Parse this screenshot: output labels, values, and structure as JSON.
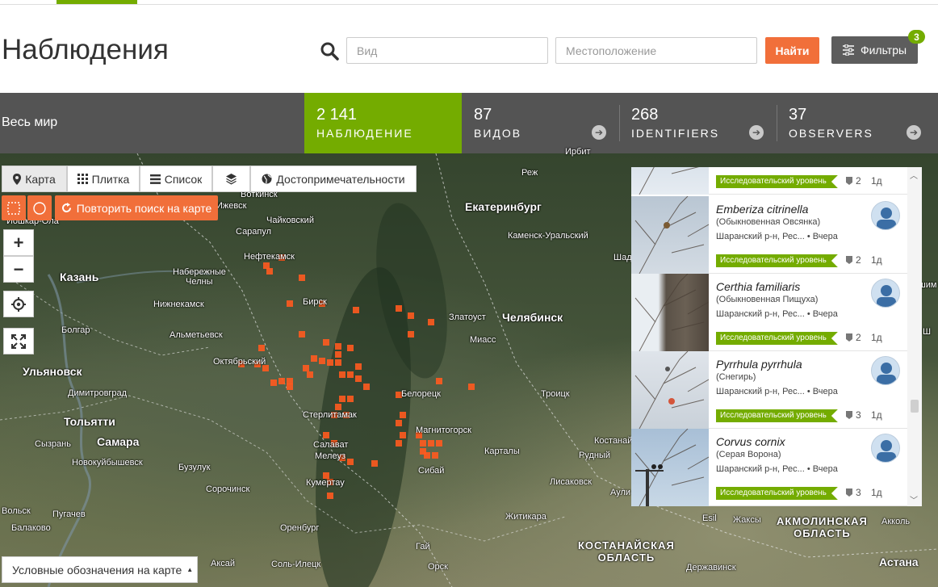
{
  "header": {
    "title": "Наблюдения",
    "species_placeholder": "Вид",
    "place_placeholder": "Местоположение",
    "find_label": "Найти",
    "filters_label": "Фильтры",
    "filters_count": "3"
  },
  "stats": {
    "place": "Весь мир",
    "observations": {
      "value": "2 141",
      "label": "НАБЛЮДЕНИЕ"
    },
    "species": {
      "value": "87",
      "label": "ВИДОВ"
    },
    "identifiers": {
      "value": "268",
      "label": "IDENTIFIERS"
    },
    "observers": {
      "value": "37",
      "label": "OBSERVERS"
    }
  },
  "map_toolbar": {
    "map": "Карта",
    "grid": "Плитка",
    "list": "Список",
    "landmarks": "Достопримечательности",
    "redo_search": "Повторить поиск на карте",
    "zoom_in": "+",
    "zoom_out": "−",
    "legend": "Условные обозначения на карте"
  },
  "map_labels": {
    "yoshkar_ola": "Йошкар-Ола",
    "votkinsk": "Воткинск",
    "izhevsk": "Ижевск",
    "chaikovsky": "Чайковский",
    "sarapul": "Сарапул",
    "neftekamsk": "Нефтекамск",
    "kazan": "Казань",
    "nab_chelny_1": "Набережные",
    "nab_chelny_2": "Челны",
    "nizhnekamsk": "Нижнекамск",
    "birsk": "Бирск",
    "bolgar": "Болгар",
    "almetyevsk": "Альметьевск",
    "oktyabrsky": "Октябрьский",
    "ulyanovsk": "Ульяновск",
    "dimitrovgrad": "Димитровград",
    "tolyatti": "Тольятти",
    "samara": "Самара",
    "syzran": "Сызрань",
    "novokuibyshevsk": "Новокуйбышевск",
    "buzuluk": "Бузулук",
    "sorochinsk": "Сорочинск",
    "sterlitamak": "Стерлитамак",
    "salavat": "Салават",
    "meleuz": "Мелеуз",
    "kumertau": "Кумертау",
    "beloretsk": "Белорецк",
    "magnitogorsk": "Магнитогорск",
    "sibay": "Сибай",
    "ekaterinburg": "Екатеринбург",
    "kamensk": "Каменск-Уральский",
    "rezh": "Реж",
    "shadrinsk": "Шадринск",
    "chelyabinsk": "Челябинск",
    "zlatoust": "Златоуст",
    "miass": "Миасс",
    "troitsk": "Троицк",
    "kartaly": "Карталы",
    "rudny": "Рудный",
    "kostanay": "Костанай",
    "lisakovsk": "Лисаковск",
    "zhitikara": "Житикара",
    "orenburg": "Оренбург",
    "volsk": "Вольск",
    "pugachev": "Пугачев",
    "balakovo": "Балаково",
    "aksai": "Аксай",
    "sol_iletsk": "Соль-Илецк",
    "gai": "Гай",
    "orsk": "Орск",
    "kostanay_region_1": "КОСТАНАЙСКАЯ",
    "kostanay_region_2": "ОБЛАСТЬ",
    "akmola_region_1": "АКМОЛИНСКАЯ",
    "akmola_region_2": "ОБЛАСТЬ",
    "esil": "Esil",
    "zhaksy": "Жаксы",
    "akkol": "Акколь",
    "astana": "Астана",
    "derzhavinsk": "Державинск",
    "auli": "Аули",
    "ishim": "Ишим",
    "irbit": "Ирбит",
    "sh": "Ш"
  },
  "observations": [
    {
      "scientific": "",
      "common": "",
      "location": "",
      "grade": "Исследовательский уровень",
      "ids": "2",
      "age": "1д"
    },
    {
      "scientific": "Emberiza citrinella",
      "common": "(Обыкновенная Овсянка)",
      "location": "Шаранский р-н, Рес...",
      "date": "Вчера",
      "grade": "Исследовательский уровень",
      "ids": "2",
      "age": "1д"
    },
    {
      "scientific": "Certhia familiaris",
      "common": "(Обыкновенная Пищуха)",
      "location": "Шаранский р-н, Рес...",
      "date": "Вчера",
      "grade": "Исследовательский уровень",
      "ids": "2",
      "age": "1д"
    },
    {
      "scientific": "Pyrrhula pyrrhula",
      "common": "(Снегирь)",
      "location": "Шаранский р-н, Рес...",
      "date": "Вчера",
      "grade": "Исследовательский уровень",
      "ids": "3",
      "age": "1д"
    },
    {
      "scientific": "Corvus cornix",
      "common": "(Серая Ворона)",
      "location": "Шаранский р-н, Рес...",
      "date": "Вчера",
      "grade": "Исследовательский уровень",
      "ids": "3",
      "age": "1д"
    }
  ],
  "colors": {
    "brand_green": "#74ac00",
    "accent_orange": "#f16f3a",
    "stats_bg": "#545454",
    "map_cell": "#ff5a1f"
  }
}
